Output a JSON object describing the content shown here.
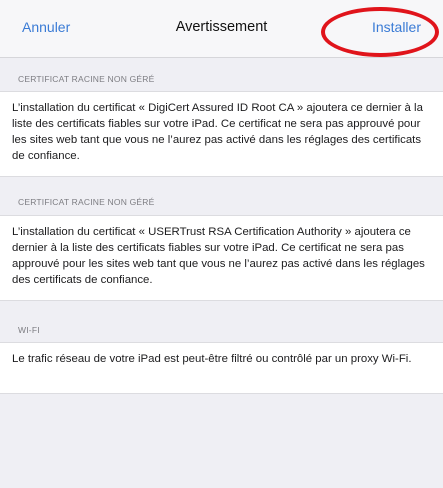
{
  "navbar": {
    "cancel_label": "Annuler",
    "title": "Avertissement",
    "install_label": "Installer"
  },
  "sections": [
    {
      "header": "CERTIFICAT RACINE NON GÉRÉ",
      "body": "L’installation du certificat « DigiCert Assured ID Root CA » ajoutera ce dernier à la liste des certificats fiables sur votre iPad. Ce certificat ne sera pas approuvé pour les sites web tant que vous ne l’aurez pas activé dans les réglages des certificats de confiance."
    },
    {
      "header": "CERTIFICAT RACINE NON GÉRÉ",
      "body": "L’installation du certificat « USERTrust RSA Certification Authority » ajoutera ce dernier à la liste des certificats fiables sur votre iPad. Ce certificat ne sera pas approuvé pour les sites web tant que vous ne l’aurez pas activé dans les réglages des certificats de confiance."
    },
    {
      "header": "WI-FI",
      "body": "Le trafic réseau de votre iPad est peut-être filtré ou contrôlé par un proxy Wi-Fi."
    }
  ],
  "colors": {
    "link": "#3a7bd5",
    "highlight": "#e0141b",
    "background": "#efeff4"
  }
}
